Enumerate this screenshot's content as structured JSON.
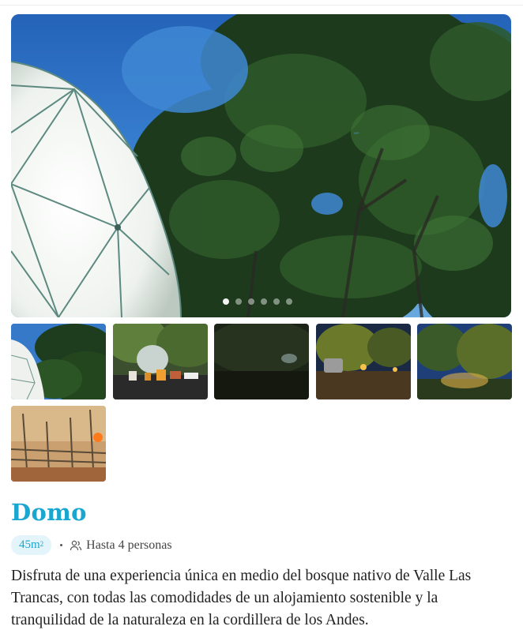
{
  "listing": {
    "title": "Domo",
    "size_value": "45m",
    "size_superscript": "2",
    "capacity_text": "Hasta 4 personas",
    "description": "Disfruta de una experiencia única en medio del bosque nativo de Valle Las Trancas, con todas las comodidades de un alojamiento sostenible y la tranquilidad de la naturaleza en la cordillera de los Andes."
  },
  "gallery": {
    "current_slide": 1,
    "slide_count": 6,
    "thumbnails": [
      {
        "subject": "dome-under-trees",
        "selected": true
      },
      {
        "subject": "breakfast-table-by-dome",
        "selected": false
      },
      {
        "subject": "dark-forest-night",
        "selected": false
      },
      {
        "subject": "car-parked-night-lights",
        "selected": false
      },
      {
        "subject": "lit-trees-dusk",
        "selected": false
      },
      {
        "subject": "wooden-fence-sunset",
        "selected": false
      }
    ]
  },
  "colors": {
    "accent": "#1aa6cf",
    "badge_bg": "#e3f5fb",
    "text": "#222222"
  },
  "icons": {
    "capacity": "users-icon"
  }
}
